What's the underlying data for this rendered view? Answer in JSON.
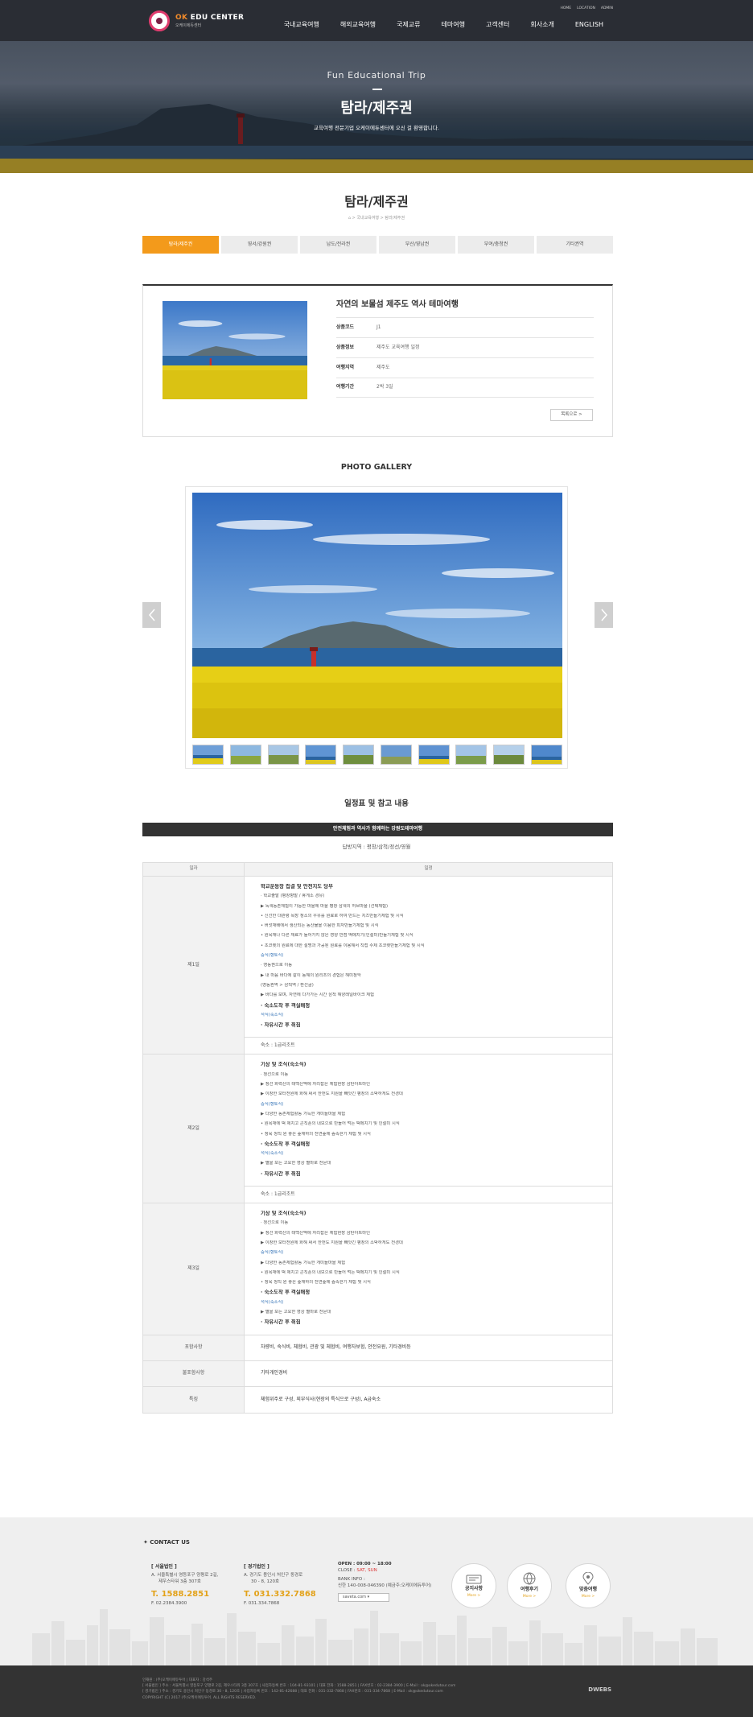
{
  "header": {
    "logo_brand": "OK",
    "logo_name": " EDU CENTER",
    "logo_sub": "오케이에듀센터",
    "util_links": [
      "HOME",
      "LOCATION",
      "ADMIN"
    ],
    "nav": [
      "국내교육여행",
      "해외교육여행",
      "국제교류",
      "테마여행",
      "고객센터",
      "회사소개",
      "ENGLISH"
    ]
  },
  "hero": {
    "subtitle_en": "Fun Educational Trip",
    "title": "탐라/제주권",
    "desc": "교육여행 전문기업 오케이에듀센터에 오신 걸 환영합니다."
  },
  "page": {
    "title": "탐라/제주권",
    "breadcrumb": "⌂ > 국내교육여행 > 탐라/제주권",
    "tabs": [
      "탐라/제주권",
      "영서/강원권",
      "남도/전라권",
      "부산/영남권",
      "부여/충청권",
      "기타권역"
    ]
  },
  "product": {
    "title": "자연의 보물섬 제주도 역사 테마여행",
    "rows": [
      {
        "k": "상품코드",
        "v": "J1"
      },
      {
        "k": "상품정보",
        "v": "제주도 교육여행 일정"
      },
      {
        "k": "여행지역",
        "v": "제주도"
      },
      {
        "k": "여행기간",
        "v": "2박 3일"
      }
    ],
    "list_btn": "목록으로 >"
  },
  "gallery": {
    "title": "PHOTO GALLERY",
    "prev": "‹",
    "next": "›",
    "thumb_count": 10
  },
  "schedule": {
    "title": "일정표 및 참고 내용",
    "banner": "안전체험과 역사가 함께하는 강원도테마여행",
    "dest": "답방지역 : 평창/삼척/정선/영월",
    "head": [
      "일자",
      "일정"
    ],
    "days": [
      {
        "label": "제1일",
        "lines": [
          {
            "t": "학교운동장 집결 및 안전지도 당부",
            "c": "h"
          },
          {
            "t": "· 학교출발 (평창향발 / 휴게소 경유)",
            "c": ""
          },
          {
            "t": "▶ 녹색농촌체험이 가능한 마을에 마을 평창 삼색의 허브마을 (선택체험)",
            "c": ""
          },
          {
            "t": "  • 신선한 대관령 목장 청소의 우유를 원료로 하여 만드는 치즈만들기체험 및 시식",
            "c": ""
          },
          {
            "t": "  • 버섯재배에서 생산되는 농산물을 이용한 피자만들기체험 및 시식",
            "c": ""
          },
          {
            "t": "  • 원목재나 다른 재료가 들어가지 않은 영양 만점 떡메치기(인절미)만들기체험 및 시식",
            "c": ""
          },
          {
            "t": "  • 초코렛의 원료에 대한 설명과 가공된 원료를 이용해서 직접 수제 초코렛만들기체험 및 시식",
            "c": ""
          },
          {
            "t": "중식(향토식)",
            "c": "blue"
          },
          {
            "t": "· 영동권으로 이동",
            "c": ""
          },
          {
            "t": "▶ 내 마음 바다에 같이 동해의 원리조의 경험은 해미정악",
            "c": ""
          },
          {
            "t": "  (영동권역 > 삼척역 / 환선굴)",
            "c": ""
          },
          {
            "t": "▶ 바다를 보며, 자연에 다가가는 시간 삼척 해양레일바이크 체험",
            "c": ""
          },
          {
            "t": "· 숙소도착 후 객실배정",
            "c": "h"
          },
          {
            "t": "석식(숙소식)",
            "c": "blue"
          },
          {
            "t": "· 자유시간 후 취침",
            "c": "h"
          }
        ],
        "stay": "숙소 : 1급리조트"
      },
      {
        "label": "제2일",
        "lines": [
          {
            "t": "기상 및 조식(숙소식)",
            "c": "h"
          },
          {
            "t": "· 정선으로 이동",
            "c": ""
          },
          {
            "t": "▶ 정선 화력산의 태백산맥에 자리잡은 체험현장 삼탄아트마인",
            "c": ""
          },
          {
            "t": "▶ 이창한 모터전원에 화해 써서 한번도 지원을 빼앗긴 평창의 소박하게도 전경대",
            "c": ""
          },
          {
            "t": "중식(향토식)",
            "c": "blue"
          },
          {
            "t": "▶ 다양한 농촌체험활동 가득한 개미들마을 체험",
            "c": ""
          },
          {
            "t": "  • 원목재에 떡 제치고 콘직푼의 내모으로 만들어 먹는 떡메치기 및 인절미 시식",
            "c": ""
          },
          {
            "t": "  • 정육 정직 원 좋은 숲재하의 천연숲에 숲속걷기 체험 및 시식",
            "c": ""
          },
          {
            "t": "· 숙소도착 후 객실배정",
            "c": "h"
          },
          {
            "t": "석식(숙소식)",
            "c": "blue"
          },
          {
            "t": "▶ 별을 보는 고요한 영상 별마로 천문대",
            "c": ""
          },
          {
            "t": "· 자유시간 후 취침",
            "c": "h"
          }
        ],
        "stay": "숙소 : 1급리조트"
      },
      {
        "label": "제3일",
        "lines": [
          {
            "t": "기상 및 조식(숙소식)",
            "c": "h"
          },
          {
            "t": "· 정선으로 이동",
            "c": ""
          },
          {
            "t": "▶ 정선 화력산의 태백산맥에 자리잡은 체험현장 삼탄아트마인",
            "c": ""
          },
          {
            "t": "▶ 이창한 모터전원에 화해 써서 한번도 지원을 빼앗긴 평창의 소박하게도 전경대",
            "c": ""
          },
          {
            "t": "중식(향토식)",
            "c": "blue"
          },
          {
            "t": "▶ 다양한 농촌체험활동 가득한 개미들마을 체험",
            "c": ""
          },
          {
            "t": "  • 원목재에 떡 제치고 콘직푼의 내모으로 만들어 먹는 떡메치기 및 인절미 시식",
            "c": ""
          },
          {
            "t": "  • 정육 정직 원 좋은 숲재하의 천연숲에 숲속걷기 체험 및 시식",
            "c": ""
          },
          {
            "t": "· 숙소도착 후 객실배정",
            "c": "h"
          },
          {
            "t": "석식(숙소식)",
            "c": "blue"
          },
          {
            "t": "▶ 별을 보는 고요한 영상 별마로 천문대",
            "c": ""
          },
          {
            "t": "· 자유시간 후 취침",
            "c": "h"
          }
        ],
        "stay": ""
      }
    ],
    "extra": [
      {
        "k": "포함사항",
        "v": "차량비, 숙식비, 체험비, 관광 및 체험비, 여행자보험, 안전요원, 기타경비등"
      },
      {
        "k": "불포함사항",
        "v": "기타개인경비"
      },
      {
        "k": "특징",
        "v": "체험위주로 구성, 외부식사(현장의 특식으로 구성), A급숙소"
      }
    ]
  },
  "footer": {
    "contact_title": "✦  CONTACT US",
    "seoul": {
      "name": "[ 서울법인 ]",
      "addr1": "A. 서울특별시 영등포구 양평로 2길,",
      "addr2": "제우스타워 3층 307호",
      "tel": "T. 1588.2851",
      "fax": "F. 02.2384.3900"
    },
    "gyeonggi": {
      "name": "[ 경기법인 ]",
      "addr1": "A. 경기도 용인시 처인구 동경로",
      "addr2": "30 - 8, 120호",
      "tel": "T. 031.332.7868",
      "fax": "F. 031.334.7868"
    },
    "open": {
      "hours": "OPEN : 09:00 ~ 18:00",
      "close_label": "CLOSE : ",
      "close_days": "SAT, SUN",
      "bank_label": "BANK INFO :",
      "bank": "신한 140-008-046390 (예금주:오케이에듀투어)",
      "select": "saveta.com  ▾"
    },
    "circles": [
      {
        "label": "공지사항",
        "more": "More >",
        "icon": "megaphone-icon"
      },
      {
        "label": "여행후기",
        "more": "More >",
        "icon": "globe-icon"
      },
      {
        "label": "맞춤여행",
        "more": "More >",
        "icon": "map-pin-icon"
      }
    ],
    "copy_lines": [
      "인재원 : (주)오케이에듀투어 | 대표자 : 강석주",
      "[ 서울법인 ] 주소 : 서울특별시 영등포구 양평로 2길, 제우스타워 3층 307호 | 사업자등록 번호 : 104-81-93101 | 대표 전화 : 1588-2851 | FAX번호 : 02-2384-3900 | E-Mail : ok@okedutour.com",
      "[ 경기법인 ] 주소 : 경기도 용인시 처인구 동경로 30 - 8, 120호 | 사업자등록 번호 : 142-81-42688 | 대표 전화 : 031-332-7868 | FAX번호 : 031-334-7868 | E-Mail : ok@okedutour.com",
      "COPYRIGHT (C) 2017 (주)오케이에듀투어. ALL RIGHTS RESERVED."
    ],
    "maker": "DWEBS"
  }
}
